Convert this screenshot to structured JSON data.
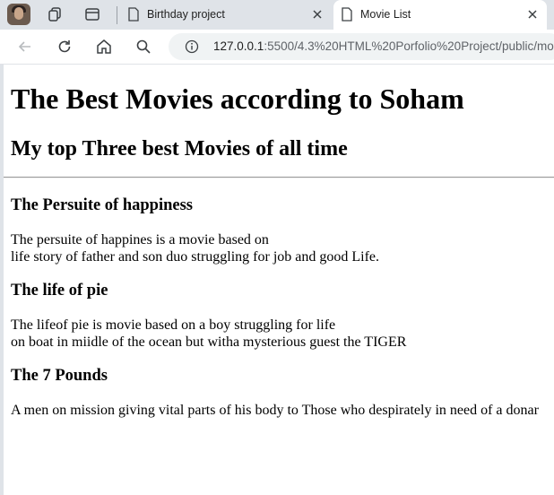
{
  "browser": {
    "tabs": [
      {
        "title": "Birthday project",
        "active": false
      },
      {
        "title": "Movie List",
        "active": true
      }
    ],
    "url_host": "127.0.0.1",
    "url_path": ":5500/4.3%20HTML%20Porfolio%20Project/public/mo"
  },
  "page": {
    "title": "The Best Movies according to Soham",
    "subtitle": "My top Three best Movies of all time",
    "movies": [
      {
        "name": "The Persuite of happiness",
        "line1": "The persuite of happines is a movie based on",
        "line2": "life story of father and son duo struggling for job and good Life."
      },
      {
        "name": "The life of pie",
        "line1": "The lifeof pie is movie based on a boy struggling for life",
        "line2": "on boat in miidle of the ocean but witha mysterious guest the TIGER"
      },
      {
        "name": "The 7 Pounds",
        "line1": "A men on mission giving vital parts of his body to Those who despirately in need of a donar"
      }
    ]
  },
  "icons": [
    "avatar",
    "tab-groups-icon",
    "sidebar-icon",
    "document-icon",
    "close-icon",
    "back-arrow-icon",
    "reload-icon",
    "home-icon",
    "search-icon",
    "info-icon"
  ]
}
